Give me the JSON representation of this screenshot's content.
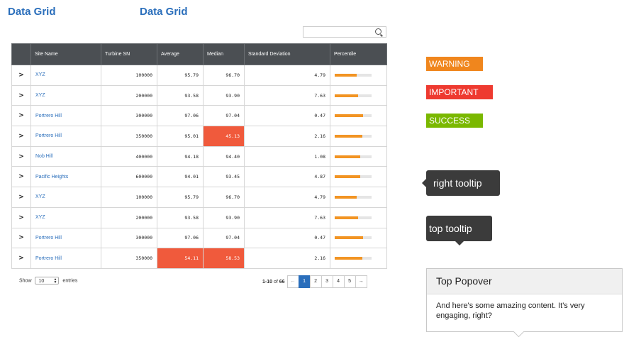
{
  "titles": [
    "Data Grid",
    "Data Grid"
  ],
  "grid": {
    "columns": [
      "Site Name",
      "Turbine SN",
      "Average",
      "Median",
      "Standard Deviation",
      "Percentile"
    ],
    "rows": [
      {
        "expand": ">",
        "site": "XYZ",
        "sn": "100000",
        "avg": "95.79",
        "median": "96.70",
        "std": "4.79",
        "pct": 0.6,
        "hl_avg": false,
        "hl_median": false
      },
      {
        "expand": ">",
        "site": "XYZ",
        "sn": "200000",
        "avg": "93.58",
        "median": "93.90",
        "std": "7.63",
        "pct": 0.63,
        "hl_avg": false,
        "hl_median": false
      },
      {
        "expand": ">",
        "site": "Portrero Hill",
        "sn": "300000",
        "avg": "97.06",
        "median": "97.04",
        "std": "0.47",
        "pct": 0.77,
        "hl_avg": false,
        "hl_median": false
      },
      {
        "expand": ">",
        "site": "Portrero Hill",
        "sn": "350000",
        "avg": "95.01",
        "median": "45.13",
        "std": "2.16",
        "pct": 0.75,
        "hl_avg": false,
        "hl_median": true
      },
      {
        "expand": ">",
        "site": "Nob Hill",
        "sn": "400000",
        "avg": "94.18",
        "median": "94.40",
        "std": "1.08",
        "pct": 0.69,
        "hl_avg": false,
        "hl_median": false
      },
      {
        "expand": ">",
        "site": "Pacific Heights",
        "sn": "600000",
        "avg": "94.01",
        "median": "93.45",
        "std": "4.87",
        "pct": 0.69,
        "hl_avg": false,
        "hl_median": false
      },
      {
        "expand": ">",
        "site": "XYZ",
        "sn": "100000",
        "avg": "95.79",
        "median": "96.70",
        "std": "4.79",
        "pct": 0.6,
        "hl_avg": false,
        "hl_median": false
      },
      {
        "expand": ">",
        "site": "XYZ",
        "sn": "200000",
        "avg": "93.58",
        "median": "93.90",
        "std": "7.63",
        "pct": 0.63,
        "hl_avg": false,
        "hl_median": false
      },
      {
        "expand": ">",
        "site": "Portrero Hill",
        "sn": "300000",
        "avg": "97.06",
        "median": "97.04",
        "std": "0.47",
        "pct": 0.77,
        "hl_avg": false,
        "hl_median": false
      },
      {
        "expand": ">",
        "site": "Portrero Hill",
        "sn": "350000",
        "avg": "54.11",
        "median": "58.53",
        "std": "2.16",
        "pct": 0.75,
        "hl_avg": true,
        "hl_median": true
      }
    ]
  },
  "footer": {
    "show_label": "Show",
    "page_size": "10",
    "entries_label": "entries",
    "range": "1-10",
    "of_label": "of",
    "total": "66",
    "pages": [
      "1",
      "2",
      "3",
      "4",
      "5"
    ],
    "prev_icon": "←",
    "next_icon": "→"
  },
  "labels": [
    {
      "text": "WARNING",
      "color": "#f0861d"
    },
    {
      "text": "IMPORTANT",
      "color": "#ee3a30"
    },
    {
      "text": "SUCCESS",
      "color": "#7ab800"
    }
  ],
  "tooltips": {
    "right": "right tooltip",
    "top": "top tooltip"
  },
  "popover": {
    "title": "Top Popover",
    "content": "And here's some amazing content. It's very engaging, right?"
  },
  "colors": {
    "accent": "#2a6ebb",
    "highlight": "#f05a3c",
    "bar": "#f29423",
    "header": "#4b4f53"
  }
}
